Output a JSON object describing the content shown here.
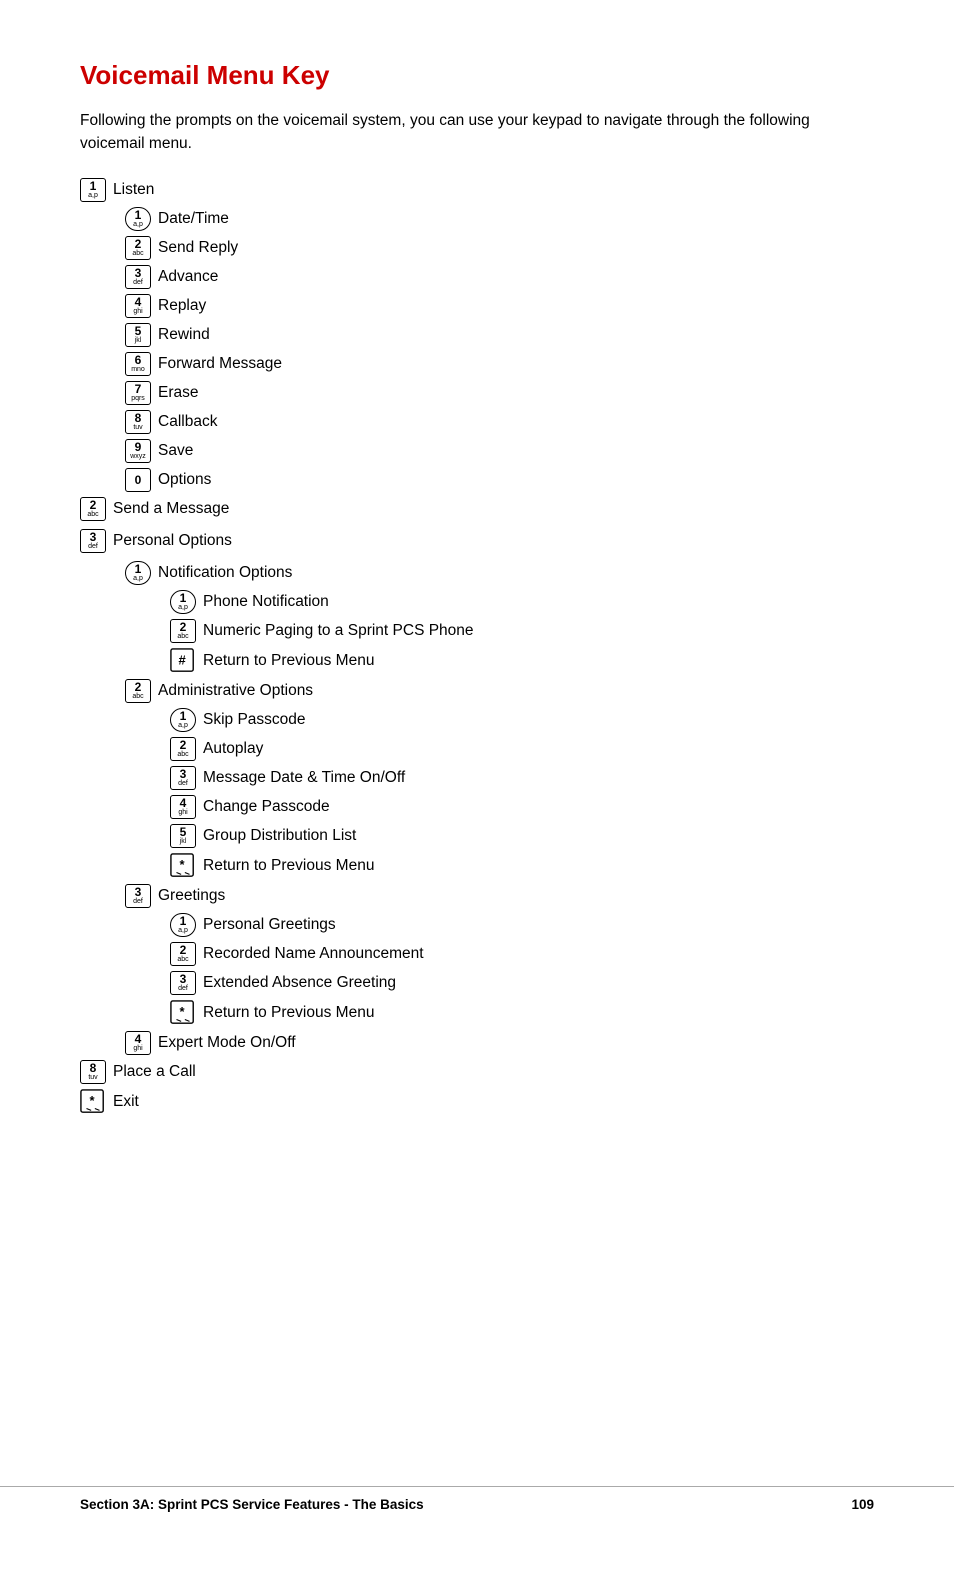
{
  "page": {
    "title": "Voicemail Menu Key",
    "intro": "Following the prompts on the voicemail system, you can use your keypad to navigate through the following voicemail menu.",
    "footer_left": "Section 3A: Sprint PCS Service Features - The Basics",
    "footer_right": "109"
  },
  "menu": [
    {
      "indent": 0,
      "key_type": "number",
      "num": "1",
      "sub": "a,p",
      "label": "Listen"
    },
    {
      "indent": 1,
      "key_type": "number_round",
      "num": "1",
      "sub": "a,p",
      "label": "Date/Time"
    },
    {
      "indent": 1,
      "key_type": "number",
      "num": "2",
      "sub": "abc",
      "label": "Send Reply"
    },
    {
      "indent": 1,
      "key_type": "number",
      "num": "3",
      "sub": "def",
      "label": "Advance"
    },
    {
      "indent": 1,
      "key_type": "number",
      "num": "4",
      "sub": "ghi",
      "label": "Replay"
    },
    {
      "indent": 1,
      "key_type": "number",
      "num": "5",
      "sub": "jkl",
      "label": "Rewind"
    },
    {
      "indent": 1,
      "key_type": "number",
      "num": "6",
      "sub": "mno",
      "label": "Forward Message"
    },
    {
      "indent": 1,
      "key_type": "number",
      "num": "7",
      "sub": "pqrs",
      "label": "Erase"
    },
    {
      "indent": 1,
      "key_type": "number",
      "num": "8",
      "sub": "tuv",
      "label": "Callback"
    },
    {
      "indent": 1,
      "key_type": "number",
      "num": "9",
      "sub": "wxyz",
      "label": "Save"
    },
    {
      "indent": 1,
      "key_type": "number",
      "num": "0",
      "sub": "",
      "label": "Options"
    },
    {
      "indent": 0,
      "key_type": "number",
      "num": "2",
      "sub": "abc",
      "label": "Send a Message"
    },
    {
      "indent": 0,
      "key_type": "number",
      "num": "3",
      "sub": "def",
      "label": "Personal Options"
    },
    {
      "indent": 1,
      "key_type": "number_round",
      "num": "1",
      "sub": "a,p",
      "label": "Notification Options"
    },
    {
      "indent": 2,
      "key_type": "number_round",
      "num": "1",
      "sub": "a,p",
      "label": "Phone Notification"
    },
    {
      "indent": 2,
      "key_type": "number",
      "num": "2",
      "sub": "abc",
      "label": "Numeric Paging to a Sprint PCS Phone"
    },
    {
      "indent": 2,
      "key_type": "hash",
      "num": "#",
      "sub": "",
      "label": "Return to Previous Menu"
    },
    {
      "indent": 1,
      "key_type": "number",
      "num": "2",
      "sub": "abc",
      "label": "Administrative Options"
    },
    {
      "indent": 2,
      "key_type": "number_round",
      "num": "1",
      "sub": "a,p",
      "label": "Skip Passcode"
    },
    {
      "indent": 2,
      "key_type": "number",
      "num": "2",
      "sub": "abc",
      "label": "Autoplay"
    },
    {
      "indent": 2,
      "key_type": "number",
      "num": "3",
      "sub": "def",
      "label": "Message Date & Time On/Off"
    },
    {
      "indent": 2,
      "key_type": "number",
      "num": "4",
      "sub": "ghi",
      "label": "Change Passcode"
    },
    {
      "indent": 2,
      "key_type": "number",
      "num": "5",
      "sub": "jkl",
      "label": "Group Distribution List"
    },
    {
      "indent": 2,
      "key_type": "star",
      "num": "*",
      "sub": "",
      "label": "Return to Previous Menu"
    },
    {
      "indent": 1,
      "key_type": "number",
      "num": "3",
      "sub": "def",
      "label": "Greetings"
    },
    {
      "indent": 2,
      "key_type": "number_round",
      "num": "1",
      "sub": "a,p",
      "label": "Personal Greetings"
    },
    {
      "indent": 2,
      "key_type": "number",
      "num": "2",
      "sub": "abc",
      "label": "Recorded Name Announcement"
    },
    {
      "indent": 2,
      "key_type": "number",
      "num": "3",
      "sub": "def",
      "label": "Extended Absence Greeting"
    },
    {
      "indent": 2,
      "key_type": "star",
      "num": "*",
      "sub": "",
      "label": "Return to Previous Menu"
    },
    {
      "indent": 1,
      "key_type": "number",
      "num": "4",
      "sub": "ghi",
      "label": "Expert Mode On/Off"
    },
    {
      "indent": 0,
      "key_type": "number",
      "num": "8",
      "sub": "tuv",
      "label": "Place a Call"
    },
    {
      "indent": 0,
      "key_type": "star",
      "num": "*",
      "sub": "",
      "label": "Exit"
    }
  ]
}
